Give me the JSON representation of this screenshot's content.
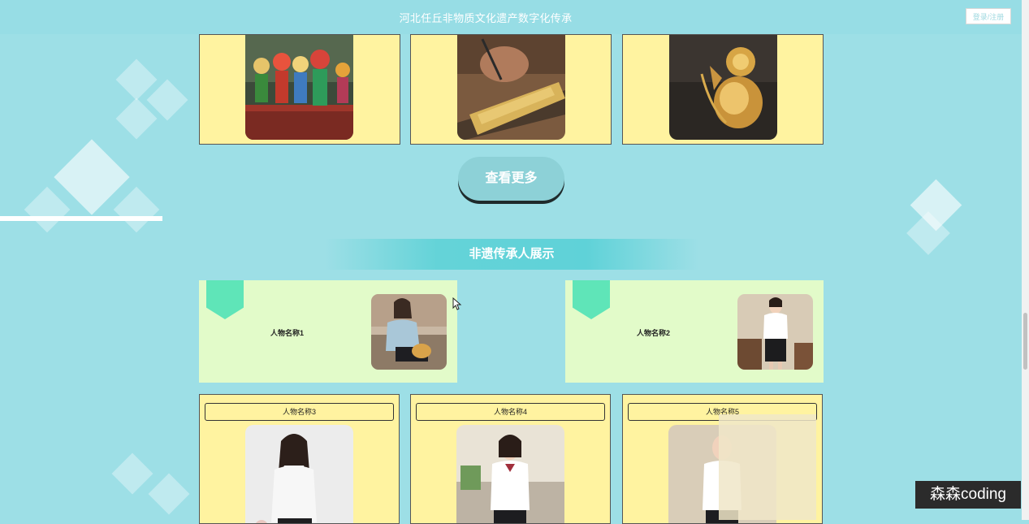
{
  "header": {
    "title": "河北任丘非物质文化遗产数字化传承",
    "login_label": "登录/注册"
  },
  "projects": [
    {
      "image": "puppet-figures-photo"
    },
    {
      "image": "calligraphy-scroll-photo"
    },
    {
      "image": "golden-gourd-photo"
    }
  ],
  "more_label": "查看更多",
  "section_title": "非遗传承人展示",
  "inheritors_featured": [
    {
      "name": "人物名称1"
    },
    {
      "name": "人物名称2"
    }
  ],
  "inheritors": [
    {
      "name": "人物名称3"
    },
    {
      "name": "人物名称4"
    },
    {
      "name": "人物名称5"
    }
  ],
  "watermark": "森森coding",
  "colors": {
    "background": "#9ddfe6",
    "card_yellow": "#fff3a0",
    "card_green": "#e2fbc9",
    "ribbon": "#5fe5b8",
    "button": "#8dd1d7"
  }
}
